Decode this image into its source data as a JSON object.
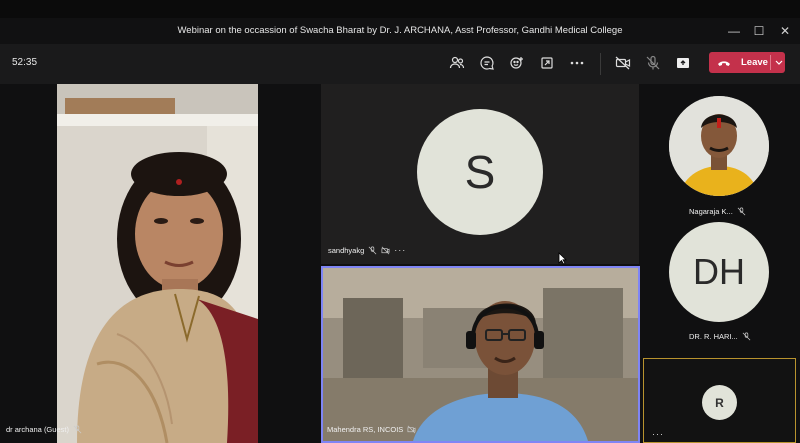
{
  "window": {
    "title": "Webinar on the occassion of Swacha Bharat by Dr. J. ARCHANA, Asst Professor, Gandhi Medical College",
    "minimize": "—",
    "maximize": "☐",
    "close": "✕"
  },
  "toolbar": {
    "timer": "52:35",
    "leave_label": "Leave",
    "icons": [
      "people-icon",
      "chat-icon",
      "reactions-icon",
      "share-tray-icon",
      "more-icon",
      "camera-off-icon",
      "mic-off-icon",
      "share-screen-icon"
    ]
  },
  "participants": {
    "archana": {
      "name": "dr archana (Guest)"
    },
    "sandhya": {
      "name": "sandhyakg",
      "initial": "S",
      "more": "···"
    },
    "mahendra": {
      "name": "Mahendra RS, INCOIS"
    },
    "nagaraja": {
      "name": "Nagaraja K..."
    },
    "hari": {
      "name": "DR. R. HARI...",
      "initials": "DH"
    },
    "r": {
      "initial": "R",
      "more": "···"
    }
  },
  "colors": {
    "leave": "#c4314b",
    "active_speaker_border": "#7f85f5",
    "avatar_bg": "#e1e3d9",
    "raised_border": "#b8932e"
  }
}
